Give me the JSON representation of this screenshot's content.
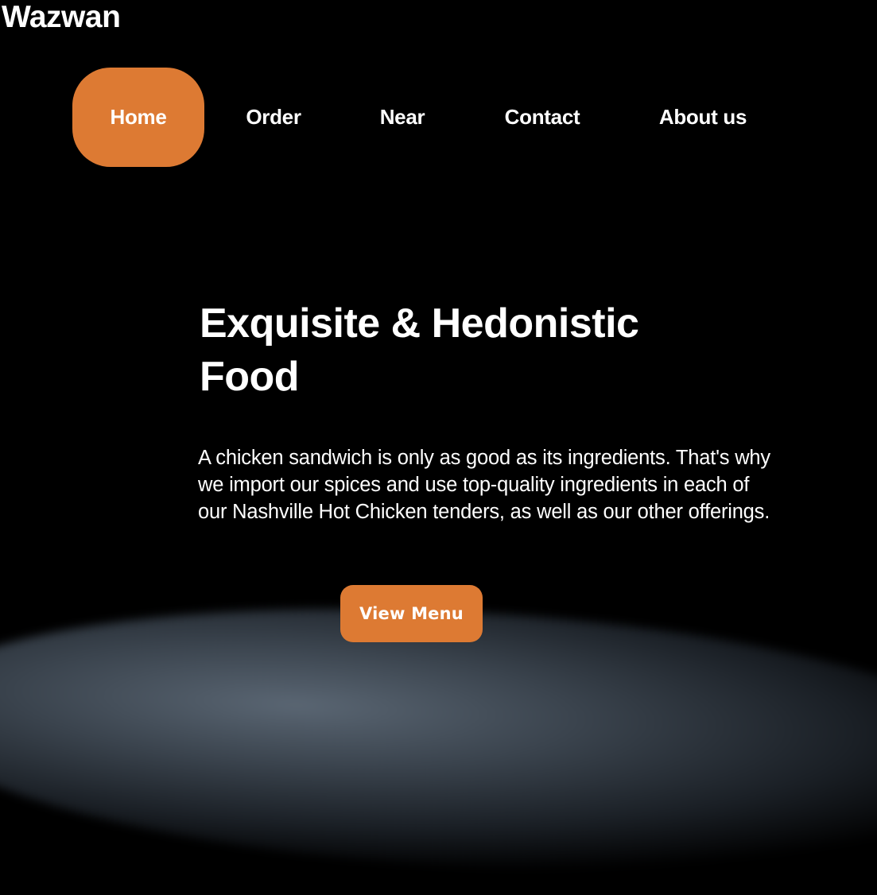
{
  "brand": {
    "name": "Wazwan"
  },
  "nav": {
    "items": [
      {
        "label": "Home",
        "active": true
      },
      {
        "label": "Order",
        "active": false
      },
      {
        "label": "Near",
        "active": false
      },
      {
        "label": "Contact",
        "active": false
      },
      {
        "label": "About us",
        "active": false
      }
    ]
  },
  "hero": {
    "title_line1": "Exquisite & Hedonistic",
    "title_line2": "Food",
    "description_line1": "A chicken sandwich is only as good as its ingredients. That's why",
    "description_line2": "we import our spices and use top-quality ingredients in each of",
    "description_line3": "our Nashville Hot Chicken tenders, as well as our other offerings.",
    "cta_label": "View Menu"
  },
  "colors": {
    "accent": "#dd7a33",
    "background": "#000000",
    "text": "#ffffff"
  }
}
